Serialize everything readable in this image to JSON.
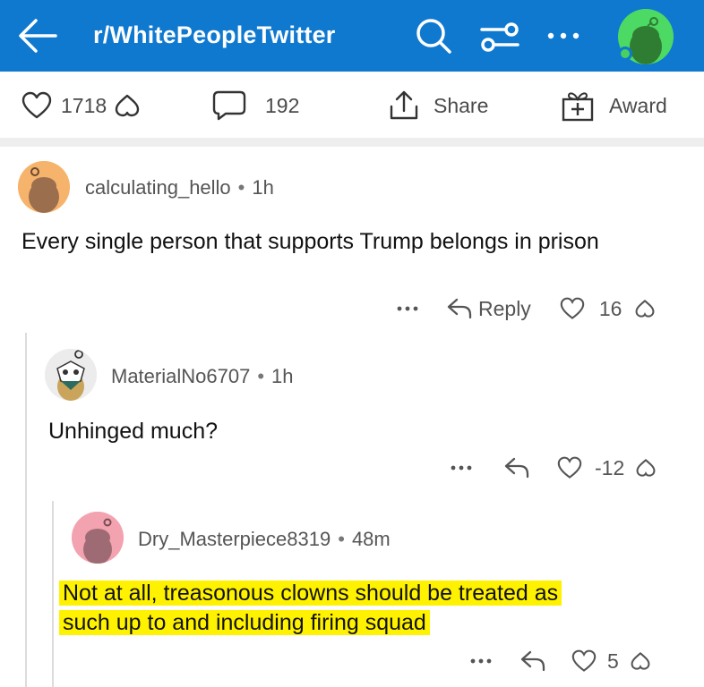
{
  "header": {
    "subreddit": "r/WhitePeopleTwitter",
    "bg_color": "#0f79d0",
    "icons": [
      "back-arrow-icon",
      "search-icon",
      "filter-icon",
      "more-icon",
      "avatar"
    ]
  },
  "post_actions": {
    "upvotes": "1718",
    "comments": "192",
    "share_label": "Share",
    "award_label": "Award"
  },
  "comments": [
    {
      "username": "calculating_hello",
      "time": "1h",
      "body": "Every single person that supports Trump belongs in prison",
      "reply_label": "Reply",
      "score": "16"
    },
    {
      "username": "MaterialNo6707",
      "time": "1h",
      "body": "Unhinged much?",
      "score": "-12"
    },
    {
      "username": "Dry_Masterpiece8319",
      "time": "48m",
      "body_line1": "Not at all, treasonous clowns should be treated as",
      "body_line2": "such up to and including firing squad",
      "highlight_color": "#fff200",
      "score": "5"
    }
  ]
}
